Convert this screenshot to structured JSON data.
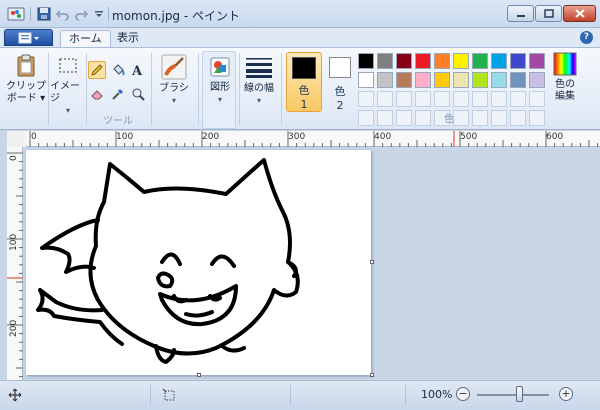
{
  "window": {
    "title": "momon.jpg - ペイント"
  },
  "tabs": [
    {
      "label": "ホーム",
      "active": true
    },
    {
      "label": "表示",
      "active": false
    }
  ],
  "ribbon": {
    "clipboard": {
      "label_line1": "クリップ",
      "label_line2": "ボード ▾"
    },
    "image": {
      "label": "イメージ",
      "arrow": "▾"
    },
    "tools": {
      "group_label": "ツール"
    },
    "brush": {
      "label": "ブラシ",
      "arrow": "▾"
    },
    "shapes": {
      "label": "図形",
      "arrow": "▾"
    },
    "line_width": {
      "label": "線の幅",
      "arrow": "▾"
    },
    "color1": {
      "label_line1": "色",
      "label_line2": "1",
      "value": "#000000"
    },
    "color2": {
      "label_line1": "色",
      "label_line2": "2",
      "value": "#ffffff"
    },
    "colors": {
      "group_label": "色"
    },
    "edit_colors": {
      "label_line1": "色の",
      "label_line2": "編集"
    },
    "palette": [
      "#000000",
      "#7f7f7f",
      "#880015",
      "#ed1c24",
      "#ff7f27",
      "#fff200",
      "#22b14c",
      "#00a2e8",
      "#3f48cc",
      "#a349a4",
      "#ffffff",
      "#c3c3c3",
      "#b97a57",
      "#ffaec9",
      "#ffc90e",
      "#efe4b0",
      "#b5e61d",
      "#99d9ea",
      "#7092be",
      "#c8bfe7",
      "",
      "",
      "",
      "",
      "",
      "",
      "",
      "",
      "",
      "",
      "",
      "",
      "",
      "",
      "",
      "",
      "",
      "",
      "",
      ""
    ]
  },
  "ruler": {
    "h_labels": [
      "0",
      "100",
      "200",
      "300",
      "400",
      "500",
      "600"
    ],
    "v_labels": [
      "0",
      "100",
      "200"
    ]
  },
  "status": {
    "zoom": "100%",
    "zoom_out": "−",
    "zoom_in": "+",
    "zoom_level": 0.5
  },
  "colors": {
    "accent_orange": "#f9c863",
    "ribbon_blue": "#1d50a6"
  }
}
